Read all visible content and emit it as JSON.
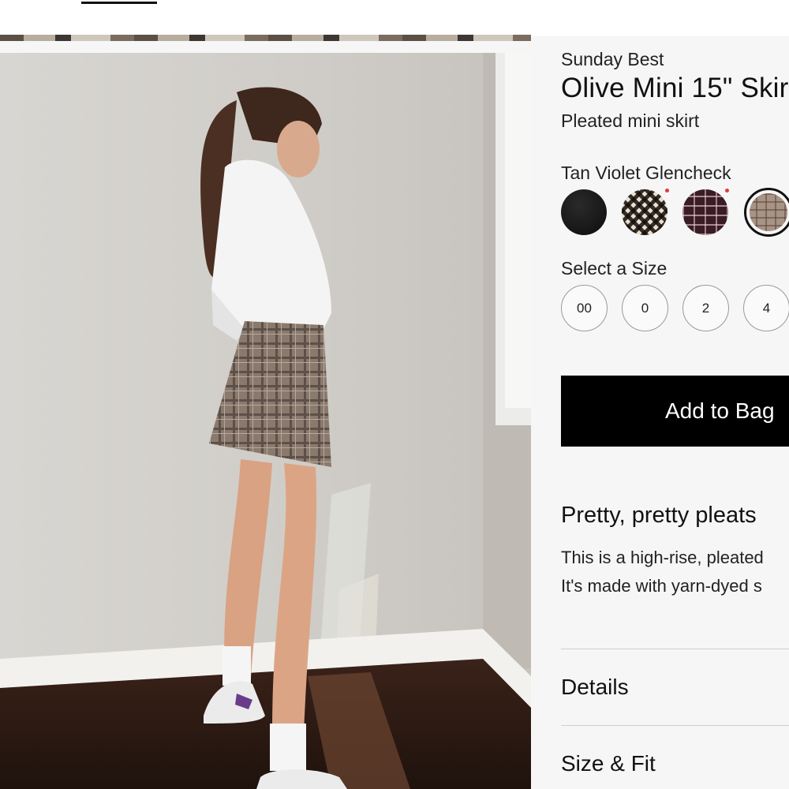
{
  "product": {
    "brand": "Sunday Best",
    "title": "Olive Mini 15\" Skir",
    "subtitle": "Pleated mini skirt",
    "selected_color": "Tan Violet Glencheck",
    "colors": [
      {
        "name": "black",
        "hex": "#111111"
      },
      {
        "name": "black-cream-check",
        "hex": "#e9dfcf"
      },
      {
        "name": "plum-plaid",
        "hex": "#3a1d24"
      },
      {
        "name": "tan-violet-glencheck",
        "hex": "#a89385",
        "selected": true
      }
    ],
    "size_label": "Select a Size",
    "sizes": [
      "00",
      "0",
      "2",
      "4"
    ],
    "add_to_bag": "Add to Bag",
    "description_heading": "Pretty, pretty pleats",
    "description_lines": [
      "This is a high-rise, pleated",
      "It's made with yarn-dyed s"
    ],
    "accordion": [
      "Details",
      "Size & Fit"
    ]
  },
  "theme": {
    "button_bg": "#000000",
    "indicator_dot": "#e23a3a"
  }
}
